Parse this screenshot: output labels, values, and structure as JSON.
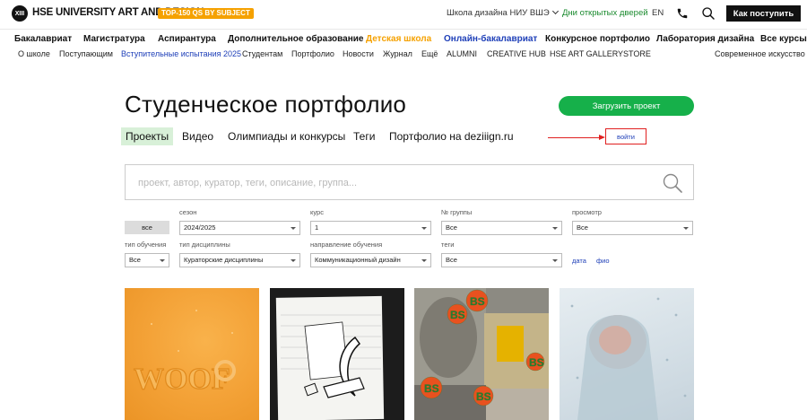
{
  "header": {
    "logo_badge": "XIII",
    "logo_text": "HSE UNIVERSITY ART AND DESIGN",
    "top150_label": "TOP-150 QS BY SUBJECT",
    "school_link": "Школа дизайна НИУ ВШЭ",
    "open_days": "Дни открытых дверей",
    "lang": "EN",
    "enroll_label": "Как поступить",
    "icons": [
      "phone-icon",
      "search-icon"
    ]
  },
  "main_nav": [
    "Бакалавриат",
    "Магистратура",
    "Аспирантура",
    "Дополнительное образование",
    "Детская школа",
    "Онлайн-бакалавриат",
    "Конкурсное портфолио",
    "Лаборатория дизайна",
    "Все курсы"
  ],
  "sub_nav": [
    "О школе",
    "Поступающим",
    "Вступительные испытания 2025",
    "Студентам",
    "Портфолио",
    "Новости",
    "Журнал",
    "Ещё",
    "ALUMNI",
    "CREATIVE HUB",
    "HSE ART GALLERY",
    "STORE",
    "Современное искусство"
  ],
  "page": {
    "title": "Студенческое портфолио",
    "upload_label": "Загрузить проект",
    "login_label": "войти",
    "tabs": [
      "Проекты",
      "Видео",
      "Олимпиады и конкурсы",
      "Теги",
      "Портфолио на deziiign.ru"
    ]
  },
  "search": {
    "placeholder": "проект, автор, куратор, теги, описание, группа..."
  },
  "filters": {
    "all_label": "все",
    "season": {
      "label": "сезон",
      "value": "2024/2025"
    },
    "course": {
      "label": "курс",
      "value": "1"
    },
    "group": {
      "label": "№ группы",
      "value": "Все"
    },
    "view": {
      "label": "просмотр",
      "value": "Все"
    },
    "study_type": {
      "label": "тип обучения",
      "value": "Все"
    },
    "discipline_type": {
      "label": "тип дисциплины",
      "value": "Кураторские дисциплины"
    },
    "direction": {
      "label": "направление обучения",
      "value": "Коммуникационный дизайн"
    },
    "tags": {
      "label": "теги",
      "value": "Все"
    },
    "sort_date": "дата",
    "sort_name": "фио"
  },
  "gallery": {
    "card1_text": "WOOF",
    "card3_badge": "BS"
  },
  "colors": {
    "accent_green": "#16b04a",
    "link_blue": "#1e3fb8",
    "kids_orange": "#f5a100",
    "annotation_red": "#e02020"
  }
}
